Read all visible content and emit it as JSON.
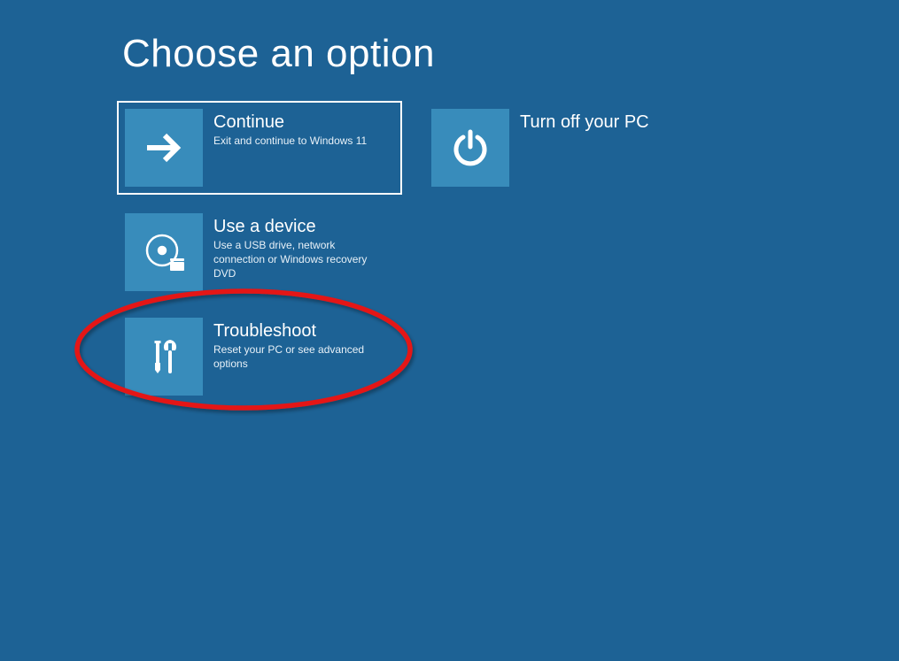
{
  "colors": {
    "background": "#1d6295",
    "tile_icon_bg": "#388cbb",
    "text": "#ffffff",
    "annotation": "#e41919"
  },
  "page": {
    "title": "Choose an option"
  },
  "options": {
    "continue_": {
      "title": "Continue",
      "desc": "Exit and continue to Windows 11",
      "selected": true
    },
    "use_device": {
      "title": "Use a device",
      "desc": "Use a USB drive, network connection or Windows recovery DVD"
    },
    "troubleshoot": {
      "title": "Troubleshoot",
      "desc": "Reset your PC or see advanced options",
      "annotated": true
    },
    "turn_off": {
      "title": "Turn off your PC",
      "desc": ""
    }
  }
}
